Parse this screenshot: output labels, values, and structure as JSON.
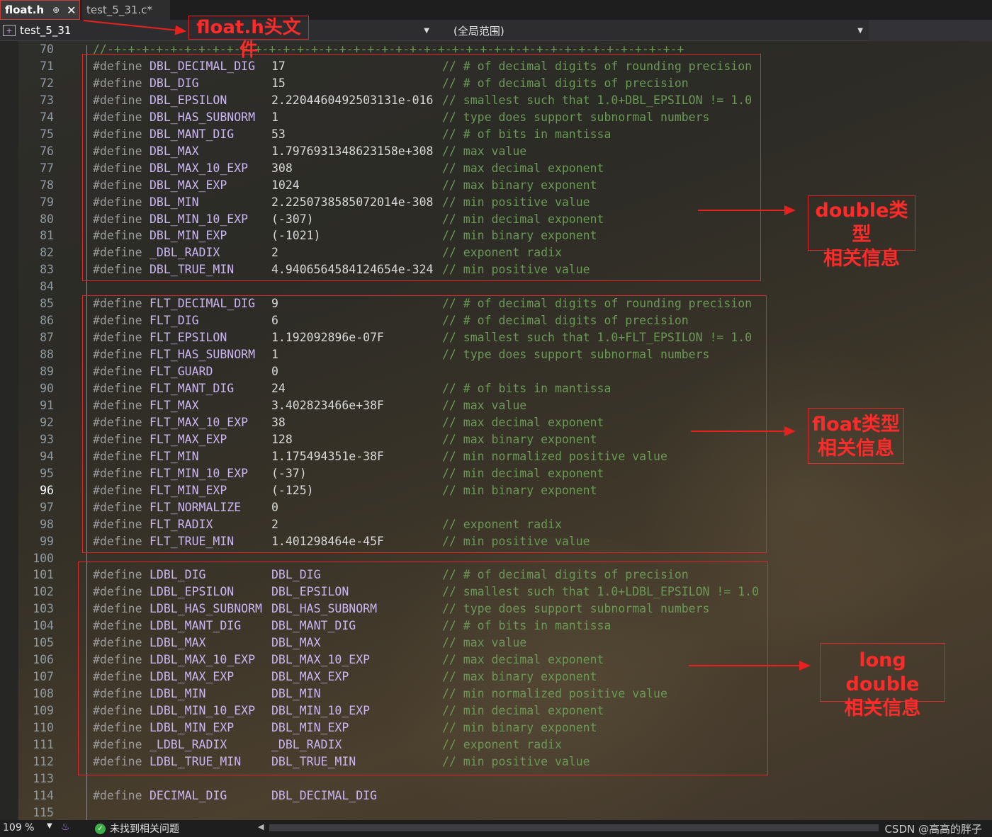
{
  "tabs": {
    "active": "float.h",
    "active_pin": "⊕",
    "active_close": "✕",
    "inactive": "test_5_31.c*"
  },
  "nav": {
    "project": "test_5_31",
    "scope": "(全局范围)"
  },
  "editor": {
    "separator_comment": "//-+-+-+-+-+-+-+-+-+-+-+-+-+-+-+-+-+-+-+-+-+-+-+-+-+-+-+-+-+-+-+-+-+-+-+-+-+-+-+-+-+",
    "current_line": "96",
    "lines": [
      {
        "n": "70",
        "sep": true
      },
      {
        "n": "71",
        "d": "#define",
        "m": "DBL_DECIMAL_DIG",
        "v": "17",
        "c": "// # of decimal digits of rounding precision"
      },
      {
        "n": "72",
        "d": "#define",
        "m": "DBL_DIG",
        "v": "15",
        "c": "// # of decimal digits of precision"
      },
      {
        "n": "73",
        "d": "#define",
        "m": "DBL_EPSILON",
        "v": "2.2204460492503131e-016",
        "c": "// smallest such that 1.0+DBL_EPSILON != 1.0"
      },
      {
        "n": "74",
        "d": "#define",
        "m": "DBL_HAS_SUBNORM",
        "v": "1",
        "c": "// type does support subnormal numbers"
      },
      {
        "n": "75",
        "d": "#define",
        "m": "DBL_MANT_DIG",
        "v": "53",
        "c": "// # of bits in mantissa"
      },
      {
        "n": "76",
        "d": "#define",
        "m": "DBL_MAX",
        "v": "1.7976931348623158e+308",
        "c": "// max value"
      },
      {
        "n": "77",
        "d": "#define",
        "m": "DBL_MAX_10_EXP",
        "v": "308",
        "c": "// max decimal exponent"
      },
      {
        "n": "78",
        "d": "#define",
        "m": "DBL_MAX_EXP",
        "v": "1024",
        "c": "// max binary exponent"
      },
      {
        "n": "79",
        "d": "#define",
        "m": "DBL_MIN",
        "v": "2.2250738585072014e-308",
        "c": "// min positive value"
      },
      {
        "n": "80",
        "d": "#define",
        "m": "DBL_MIN_10_EXP",
        "v": "(-307)",
        "c": "// min decimal exponent"
      },
      {
        "n": "81",
        "d": "#define",
        "m": "DBL_MIN_EXP",
        "v": "(-1021)",
        "c": "// min binary exponent"
      },
      {
        "n": "82",
        "d": "#define",
        "m": "_DBL_RADIX",
        "v": "2",
        "c": "// exponent radix"
      },
      {
        "n": "83",
        "d": "#define",
        "m": "DBL_TRUE_MIN",
        "v": "4.9406564584124654e-324",
        "c": "// min positive value"
      },
      {
        "n": "84"
      },
      {
        "n": "85",
        "d": "#define",
        "m": "FLT_DECIMAL_DIG",
        "v": "9",
        "c": "// # of decimal digits of rounding precision"
      },
      {
        "n": "86",
        "d": "#define",
        "m": "FLT_DIG",
        "v": "6",
        "c": "// # of decimal digits of precision"
      },
      {
        "n": "87",
        "d": "#define",
        "m": "FLT_EPSILON",
        "v": "1.192092896e-07F",
        "c": "// smallest such that 1.0+FLT_EPSILON != 1.0"
      },
      {
        "n": "88",
        "d": "#define",
        "m": "FLT_HAS_SUBNORM",
        "v": "1",
        "c": "// type does support subnormal numbers"
      },
      {
        "n": "89",
        "d": "#define",
        "m": "FLT_GUARD",
        "v": "0",
        "c": ""
      },
      {
        "n": "90",
        "d": "#define",
        "m": "FLT_MANT_DIG",
        "v": "24",
        "c": "// # of bits in mantissa"
      },
      {
        "n": "91",
        "d": "#define",
        "m": "FLT_MAX",
        "v": "3.402823466e+38F",
        "c": "// max value"
      },
      {
        "n": "92",
        "d": "#define",
        "m": "FLT_MAX_10_EXP",
        "v": "38",
        "c": "// max decimal exponent"
      },
      {
        "n": "93",
        "d": "#define",
        "m": "FLT_MAX_EXP",
        "v": "128",
        "c": "// max binary exponent"
      },
      {
        "n": "94",
        "d": "#define",
        "m": "FLT_MIN",
        "v": "1.175494351e-38F",
        "c": "// min normalized positive value"
      },
      {
        "n": "95",
        "d": "#define",
        "m": "FLT_MIN_10_EXP",
        "v": "(-37)",
        "c": "// min decimal exponent"
      },
      {
        "n": "96",
        "d": "#define",
        "m": "FLT_MIN_EXP",
        "v": "(-125)",
        "c": "// min binary exponent"
      },
      {
        "n": "97",
        "d": "#define",
        "m": "FLT_NORMALIZE",
        "v": "0",
        "c": ""
      },
      {
        "n": "98",
        "d": "#define",
        "m": "FLT_RADIX",
        "v": "2",
        "c": "// exponent radix"
      },
      {
        "n": "99",
        "d": "#define",
        "m": "FLT_TRUE_MIN",
        "v": "1.401298464e-45F",
        "c": "// min positive value"
      },
      {
        "n": "100"
      },
      {
        "n": "101",
        "d": "#define",
        "m": "LDBL_DIG",
        "v": "DBL_DIG",
        "vm": true,
        "c": "// # of decimal digits of precision"
      },
      {
        "n": "102",
        "d": "#define",
        "m": "LDBL_EPSILON",
        "v": "DBL_EPSILON",
        "vm": true,
        "c": "// smallest such that 1.0+LDBL_EPSILON != 1.0"
      },
      {
        "n": "103",
        "d": "#define",
        "m": "LDBL_HAS_SUBNORM",
        "v": "DBL_HAS_SUBNORM",
        "vm": true,
        "c": "// type does support subnormal numbers"
      },
      {
        "n": "104",
        "d": "#define",
        "m": "LDBL_MANT_DIG",
        "v": "DBL_MANT_DIG",
        "vm": true,
        "c": "// # of bits in mantissa"
      },
      {
        "n": "105",
        "d": "#define",
        "m": "LDBL_MAX",
        "v": "DBL_MAX",
        "vm": true,
        "c": "// max value"
      },
      {
        "n": "106",
        "d": "#define",
        "m": "LDBL_MAX_10_EXP",
        "v": "DBL_MAX_10_EXP",
        "vm": true,
        "c": "// max decimal exponent"
      },
      {
        "n": "107",
        "d": "#define",
        "m": "LDBL_MAX_EXP",
        "v": "DBL_MAX_EXP",
        "vm": true,
        "c": "// max binary exponent"
      },
      {
        "n": "108",
        "d": "#define",
        "m": "LDBL_MIN",
        "v": "DBL_MIN",
        "vm": true,
        "c": "// min normalized positive value"
      },
      {
        "n": "109",
        "d": "#define",
        "m": "LDBL_MIN_10_EXP",
        "v": "DBL_MIN_10_EXP",
        "vm": true,
        "c": "// min decimal exponent"
      },
      {
        "n": "110",
        "d": "#define",
        "m": "LDBL_MIN_EXP",
        "v": "DBL_MIN_EXP",
        "vm": true,
        "c": "// min binary exponent"
      },
      {
        "n": "111",
        "d": "#define",
        "m": "_LDBL_RADIX",
        "v": "_DBL_RADIX",
        "vm": true,
        "c": "// exponent radix"
      },
      {
        "n": "112",
        "d": "#define",
        "m": "LDBL_TRUE_MIN",
        "v": "DBL_TRUE_MIN",
        "vm": true,
        "c": "// min positive value"
      },
      {
        "n": "113"
      },
      {
        "n": "114",
        "d": "#define",
        "m": "DECIMAL_DIG",
        "v": "DBL_DECIMAL_DIG",
        "vm": true,
        "c": ""
      },
      {
        "n": "115"
      }
    ]
  },
  "annotations": {
    "header_note": "float.h头文件",
    "double_note": [
      "double类型",
      "相关信息"
    ],
    "float_note": [
      "float类型",
      "相关信息"
    ],
    "long_double_note": [
      "long double",
      "相关信息"
    ],
    "color": "#e0282b"
  },
  "status": {
    "zoom": "109 %",
    "issues": "未找到相关问题",
    "watermark": "CSDN @高高的胖子"
  }
}
